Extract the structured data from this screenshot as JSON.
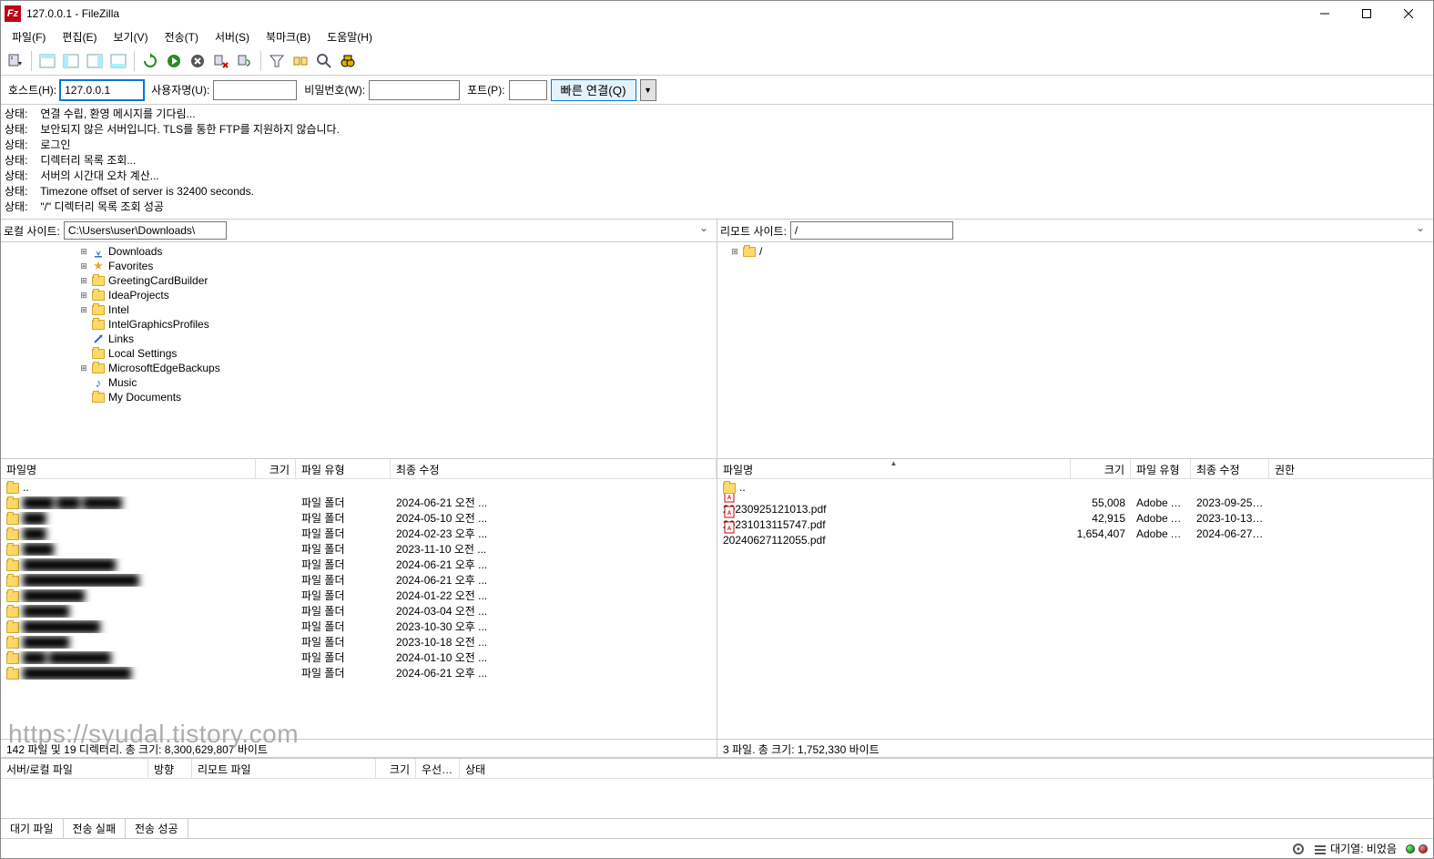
{
  "title": "127.0.0.1 - FileZilla",
  "menubar": [
    "파일(F)",
    "편집(E)",
    "보기(V)",
    "전송(T)",
    "서버(S)",
    "북마크(B)",
    "도움말(H)"
  ],
  "quickconnect": {
    "host_label": "호스트(H):",
    "host_value": "127.0.0.1",
    "user_label": "사용자명(U):",
    "user_value": "",
    "pass_label": "비밀번호(W):",
    "pass_value": "",
    "port_label": "포트(P):",
    "port_value": "",
    "btn_label": "빠른 연결(Q)"
  },
  "log": [
    {
      "label": "상태:",
      "msg": "연결 수립, 환영 메시지를 기다림..."
    },
    {
      "label": "상태:",
      "msg": "보안되지 않은 서버입니다. TLS를 통한 FTP를 지원하지 않습니다."
    },
    {
      "label": "상태:",
      "msg": "로그인"
    },
    {
      "label": "상태:",
      "msg": "디렉터리 목록 조회..."
    },
    {
      "label": "상태:",
      "msg": "서버의 시간대 오차 계산..."
    },
    {
      "label": "상태:",
      "msg": "Timezone offset of server is 32400 seconds."
    },
    {
      "label": "상태:",
      "msg": "\"/\" 디렉터리 목록 조회 성공"
    }
  ],
  "local": {
    "site_label": "로컬 사이트:",
    "path": "C:\\Users\\user\\Downloads\\",
    "tree": [
      {
        "indent": 5,
        "expand": "+",
        "icon": "download",
        "name": "Downloads"
      },
      {
        "indent": 5,
        "expand": "+",
        "icon": "star",
        "name": "Favorites"
      },
      {
        "indent": 5,
        "expand": "+",
        "icon": "folder",
        "name": "GreetingCardBuilder"
      },
      {
        "indent": 5,
        "expand": "+",
        "icon": "folder",
        "name": "IdeaProjects"
      },
      {
        "indent": 5,
        "expand": "+",
        "icon": "folder",
        "name": "Intel"
      },
      {
        "indent": 5,
        "expand": "",
        "icon": "folder",
        "name": "IntelGraphicsProfiles"
      },
      {
        "indent": 5,
        "expand": "",
        "icon": "link",
        "name": "Links"
      },
      {
        "indent": 5,
        "expand": "",
        "icon": "folder",
        "name": "Local Settings"
      },
      {
        "indent": 5,
        "expand": "+",
        "icon": "folder",
        "name": "MicrosoftEdgeBackups"
      },
      {
        "indent": 5,
        "expand": "",
        "icon": "music",
        "name": "Music"
      },
      {
        "indent": 5,
        "expand": "",
        "icon": "folder",
        "name": "My Documents"
      }
    ],
    "headers": {
      "name": "파일명",
      "size": "크기",
      "type": "파일 유형",
      "modified": "최종 수정"
    },
    "files": [
      {
        "name": "..",
        "size": "",
        "type": "",
        "modified": ""
      },
      {
        "name": "████ ███ █████",
        "size": "",
        "type": "파일 폴더",
        "modified": "2024-06-21 오전 ..."
      },
      {
        "name": "███",
        "size": "",
        "type": "파일 폴더",
        "modified": "2024-05-10 오전 ..."
      },
      {
        "name": "███",
        "size": "",
        "type": "파일 폴더",
        "modified": "2024-02-23 오후 ..."
      },
      {
        "name": "████",
        "size": "",
        "type": "파일 폴더",
        "modified": "2023-11-10 오전 ..."
      },
      {
        "name": "████████████",
        "size": "",
        "type": "파일 폴더",
        "modified": "2024-06-21 오후 ..."
      },
      {
        "name": "███████████████",
        "size": "",
        "type": "파일 폴더",
        "modified": "2024-06-21 오후 ..."
      },
      {
        "name": "████████",
        "size": "",
        "type": "파일 폴더",
        "modified": "2024-01-22 오전 ..."
      },
      {
        "name": "██████",
        "size": "",
        "type": "파일 폴더",
        "modified": "2024-03-04 오전 ..."
      },
      {
        "name": "██████████",
        "size": "",
        "type": "파일 폴더",
        "modified": "2023-10-30 오후 ..."
      },
      {
        "name": "██████",
        "size": "",
        "type": "파일 폴더",
        "modified": "2023-10-18 오전 ..."
      },
      {
        "name": "███ ████████",
        "size": "",
        "type": "파일 폴더",
        "modified": "2024-01-10 오전 ..."
      },
      {
        "name": "██████████████",
        "size": "",
        "type": "파일 폴더",
        "modified": "2024-06-21 오후 ..."
      }
    ],
    "summary": "142 파일 및 19 디렉터리. 총 크기: 8,300,629,807 바이트"
  },
  "remote": {
    "site_label": "리모트 사이트:",
    "path": "/",
    "tree": [
      {
        "indent": 0,
        "expand": "-",
        "icon": "folder",
        "name": "/"
      }
    ],
    "headers": {
      "name": "파일명",
      "size": "크기",
      "type": "파일 유형",
      "modified": "최종 수정",
      "perm": "권한"
    },
    "files": [
      {
        "name": "..",
        "size": "",
        "type": "",
        "modified": "",
        "icon": "folder"
      },
      {
        "name": "20230925121013.pdf",
        "size": "55,008",
        "type": "Adobe Acr...",
        "modified": "2023-09-25 ...",
        "icon": "pdf"
      },
      {
        "name": "20231013115747.pdf",
        "size": "42,915",
        "type": "Adobe Acr...",
        "modified": "2023-10-13 ...",
        "icon": "pdf"
      },
      {
        "name": "20240627112055.pdf",
        "size": "1,654,407",
        "type": "Adobe Acr...",
        "modified": "2024-06-27 ...",
        "icon": "pdf"
      }
    ],
    "summary": "3 파일. 총 크기: 1,752,330 바이트"
  },
  "queue": {
    "headers": {
      "serverlocal": "서버/로컬 파일",
      "dir": "방향",
      "remotefile": "리모트 파일",
      "size": "크기",
      "priority": "우선 ...",
      "status": "상태"
    },
    "tabs": {
      "queued": "대기 파일",
      "failed": "전송 실패",
      "success": "전송 성공"
    }
  },
  "statusbar": {
    "queue_label": "대기열: 비었음"
  },
  "watermark": "https://syudal.tistory.com"
}
